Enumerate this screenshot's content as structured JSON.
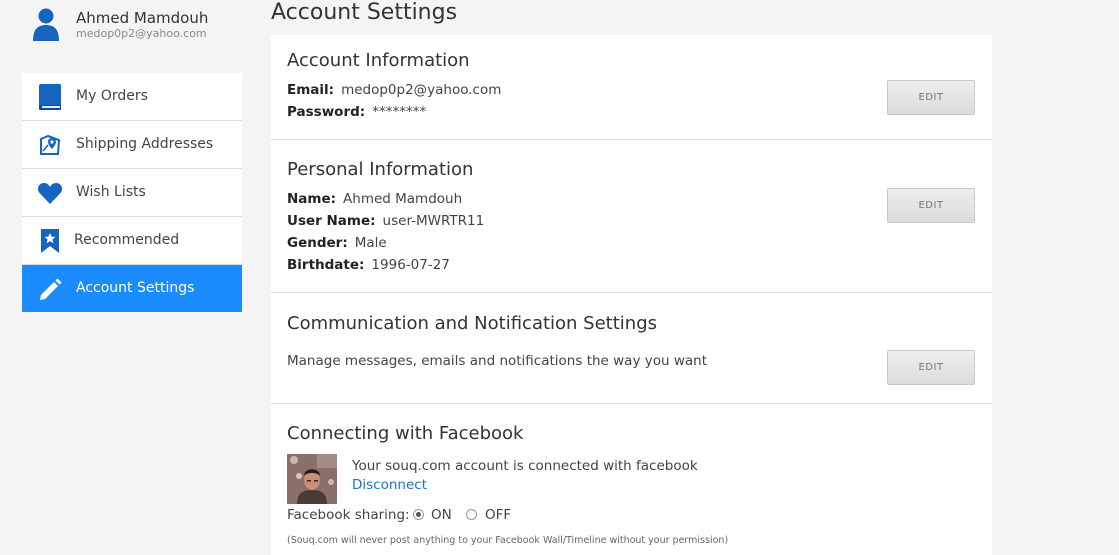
{
  "user": {
    "name": "Ahmed Mamdouh",
    "email": "medop0p2@yahoo.com"
  },
  "sidebar": {
    "items": [
      {
        "label": "My Orders",
        "icon": "book-icon"
      },
      {
        "label": "Shipping Addresses",
        "icon": "map-pin-icon"
      },
      {
        "label": "Wish Lists",
        "icon": "heart-icon"
      },
      {
        "label": "Recommended",
        "icon": "bookmark-star-icon"
      },
      {
        "label": "Account Settings",
        "icon": "pencil-icon",
        "active": true
      }
    ]
  },
  "page": {
    "title": "Account Settings"
  },
  "account_info": {
    "title": "Account Information",
    "email_label": "Email:",
    "email_value": "medop0p2@yahoo.com",
    "password_label": "Password:",
    "password_value": "********",
    "edit_label": "EDIT"
  },
  "personal_info": {
    "title": "Personal Information",
    "name_label": "Name:",
    "name_value": "Ahmed Mamdouh",
    "username_label": "User Name:",
    "username_value": "user-MWRTR11",
    "gender_label": "Gender:",
    "gender_value": "Male",
    "birthdate_label": "Birthdate:",
    "birthdate_value": "1996-07-27",
    "edit_label": "EDIT"
  },
  "communication": {
    "title": "Communication and Notification Settings",
    "description": "Manage messages, emails and notifications the way you want",
    "edit_label": "EDIT"
  },
  "facebook": {
    "title": "Connecting with Facebook",
    "status_text": "Your souq.com account is connected with facebook",
    "disconnect_label": "Disconnect",
    "sharing_label": "Facebook sharing:",
    "on_label": "ON",
    "off_label": "OFF",
    "sharing_selected": "ON",
    "note": "(Souq.com will never post anything to your Facebook Wall/Timeline without your permission)"
  },
  "colors": {
    "accent": "#1a8cff",
    "icon_blue": "#1565c0",
    "link": "#1a73c8"
  }
}
